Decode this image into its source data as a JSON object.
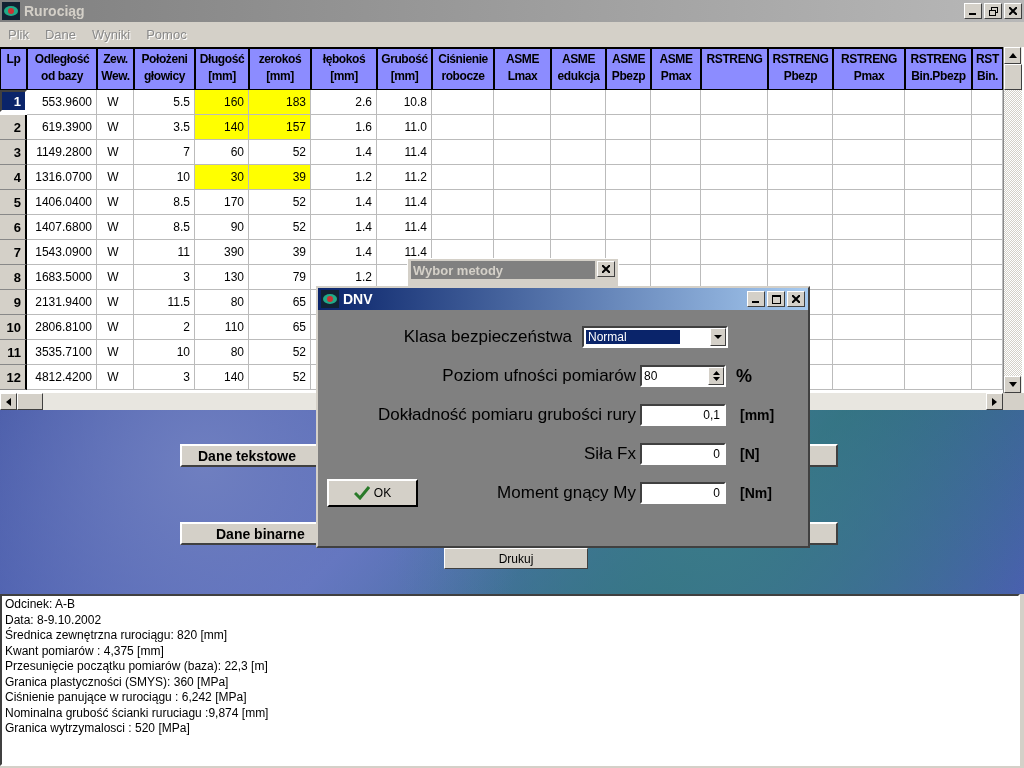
{
  "window": {
    "title": "Rurociąg"
  },
  "menu": [
    {
      "label": "Plik",
      "disabled": true
    },
    {
      "label": "Dane",
      "disabled": true
    },
    {
      "label": "Wyniki",
      "disabled": true
    },
    {
      "label": "Pomoc",
      "disabled": true
    }
  ],
  "table": {
    "columns": [
      "Lp",
      "Odległość od bazy",
      "Zew. Wew.",
      "Położeni głowicy",
      "Długość [mm]",
      "zerokoś [mm]",
      "łębokoś [mm]",
      "Grubość [mm]",
      "Ciśnienie robocze",
      "ASME Lmax",
      "ASME edukcja",
      "ASME Pbezp",
      "ASME Pmax",
      "RSTRENG",
      "RSTRENG Pbezp",
      "RSTRENG Pmax",
      "RSTRENG Bin.Pbezp",
      "RST Bin."
    ],
    "rows": [
      {
        "selected": true,
        "flagged": true,
        "cells": [
          "1",
          "553.9600",
          "W",
          "5.5",
          "160",
          "183",
          "2.6",
          "10.8"
        ]
      },
      {
        "selected": false,
        "flagged": true,
        "cells": [
          "2",
          "619.3900",
          "W",
          "3.5",
          "140",
          "157",
          "1.6",
          "11.0"
        ]
      },
      {
        "selected": false,
        "flagged": false,
        "cells": [
          "3",
          "1149.2800",
          "W",
          "7",
          "60",
          "52",
          "1.4",
          "11.4"
        ]
      },
      {
        "selected": false,
        "flagged": true,
        "cells": [
          "4",
          "1316.0700",
          "W",
          "10",
          "30",
          "39",
          "1.2",
          "11.2"
        ]
      },
      {
        "selected": false,
        "flagged": false,
        "cells": [
          "5",
          "1406.0400",
          "W",
          "8.5",
          "170",
          "52",
          "1.4",
          "11.4"
        ]
      },
      {
        "selected": false,
        "flagged": false,
        "cells": [
          "6",
          "1407.6800",
          "W",
          "8.5",
          "90",
          "52",
          "1.4",
          "11.4"
        ]
      },
      {
        "selected": false,
        "flagged": false,
        "cells": [
          "7",
          "1543.0900",
          "W",
          "11",
          "390",
          "39",
          "1.4",
          "11.4"
        ]
      },
      {
        "selected": false,
        "flagged": false,
        "cells": [
          "8",
          "1683.5000",
          "W",
          "3",
          "130",
          "79",
          "1.2"
        ]
      },
      {
        "selected": false,
        "flagged": false,
        "cells": [
          "9",
          "2131.9400",
          "W",
          "11.5",
          "80",
          "65"
        ]
      },
      {
        "selected": false,
        "flagged": false,
        "cells": [
          "10",
          "2806.8100",
          "W",
          "2",
          "110",
          "65"
        ]
      },
      {
        "selected": false,
        "flagged": false,
        "cells": [
          "11",
          "3535.7100",
          "W",
          "10",
          "80",
          "52"
        ]
      },
      {
        "selected": false,
        "flagged": false,
        "cells": [
          "12",
          "4812.4200",
          "W",
          "3",
          "140",
          "52"
        ]
      }
    ]
  },
  "buttons": {
    "text_data": "Dane tekstowe",
    "binary_data": "Dane binarne",
    "print": "Drukuj"
  },
  "back_window": {
    "title": "Wybor metody"
  },
  "dialog": {
    "title": "DNV",
    "ok": "OK",
    "fields": [
      {
        "kind": "select",
        "label": "Klasa bezpieczeństwa",
        "value": "Normal"
      },
      {
        "kind": "spin",
        "label": "Poziom ufności pomiarów",
        "value": "80",
        "unit": "%"
      },
      {
        "kind": "text",
        "label": "Dokładność pomiaru grubości rury",
        "value": "0,1",
        "unit": "[mm]"
      },
      {
        "kind": "text",
        "label": "Siła Fx",
        "value": "0",
        "unit": "[N]"
      },
      {
        "kind": "text",
        "label": "Moment gnący My",
        "value": "0",
        "unit": "[Nm]"
      }
    ]
  },
  "info": [
    "Odcinek: A-B",
    "Data: 8-9.10.2002",
    "Średnica zewnętrzna rurociągu: 820 [mm]",
    "Kwant pomiarów : 4,375 [mm]",
    "Przesunięcie początku pomiarów (baza): 22,3 [m]",
    "Granica plastyczności (SMYS): 360 [MPa]",
    "Ciśnienie panujące w rurociągu : 6,242 [MPa]",
    "Nominalna grubość ścianki ruruciagu :9,874 [mm]",
    "Granica wytrzymalosci : 520 [MPa]"
  ]
}
